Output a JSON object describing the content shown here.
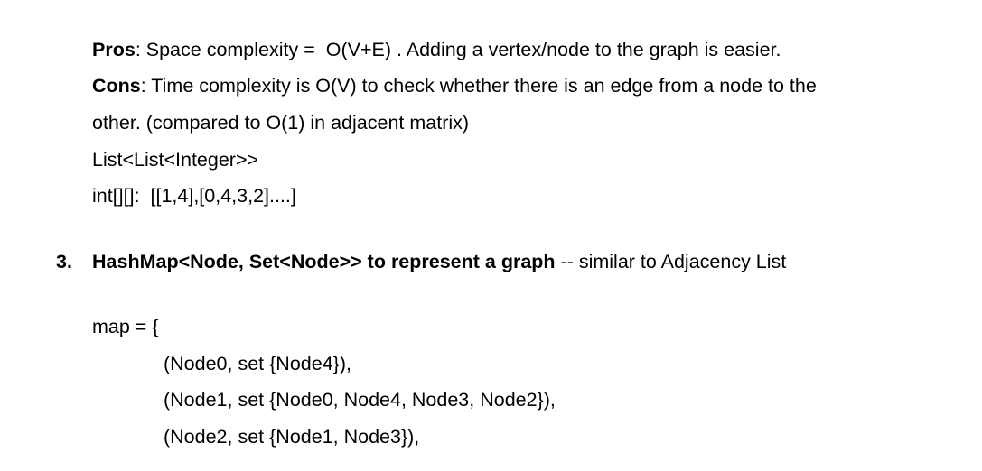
{
  "pros": {
    "label": "Pros",
    "text": ": Space complexity =  O(V+E) . Adding a vertex/node to the graph is easier."
  },
  "cons": {
    "label": "Cons",
    "text": ": Time complexity is O(V) to check whether there is an edge from a node to the"
  },
  "cons_continued": "other. (compared to O(1) in adjacent matrix)",
  "list_type": "List<List<Integer>>",
  "int_array": "int[][]:  [[1,4],[0,4,3,2]....]",
  "section3": {
    "number": "3.",
    "heading": "HashMap<Node, Set<Node>> to represent a graph",
    "suffix": " -- similar to Adjacency List"
  },
  "map_open": "map = {",
  "map_entries": [
    "(Node0, set {Node4}),",
    "(Node1, set {Node0, Node4, Node3, Node2}),",
    "(Node2, set {Node1, Node3}),"
  ]
}
